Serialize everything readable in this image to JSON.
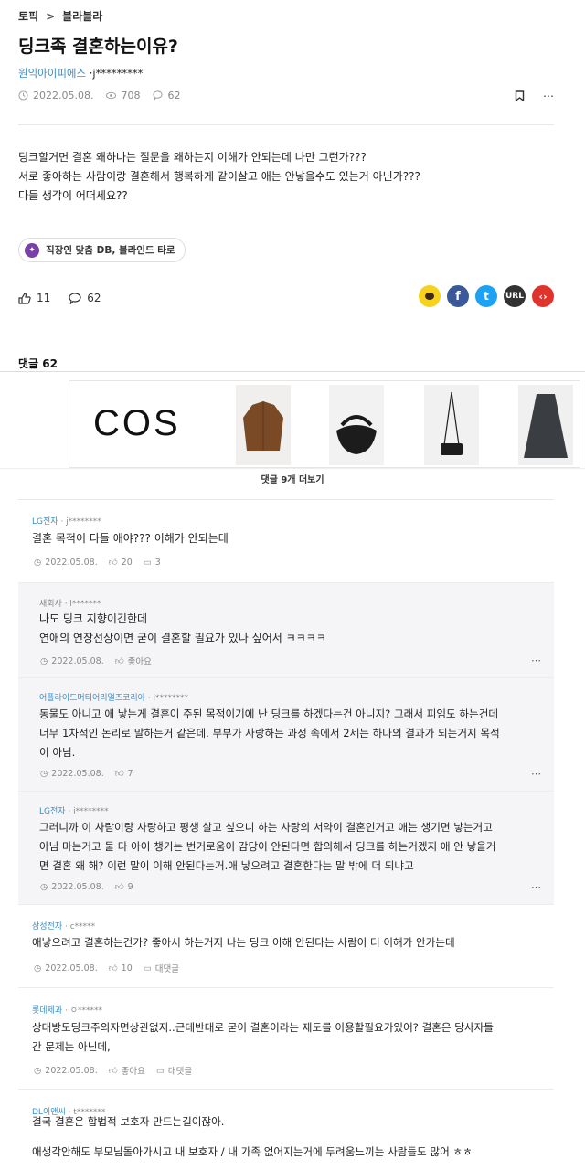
{
  "breadcrumb": {
    "topic": "토픽",
    "separator": ">",
    "board": "블라블라"
  },
  "post": {
    "title": "딩크족 결혼하는이유?",
    "company": "원익아이피에스",
    "author": "·j*********",
    "date": "2022.05.08.",
    "views": "708",
    "comments": "62",
    "lines": [
      "딩크할거면 결혼 왜하나는 질문을 왜하는지 이해가 안되는데 나만 그런가???",
      "서로 좋아하는 사람이랑 결혼해서 행복하게 같이살고 애는 안낳을수도 있는거 아닌가???",
      "다들 생각이 어떠세요??"
    ],
    "tag": "직장인 맞춤 DB, 블라인드 타로",
    "likes": "11",
    "comment_count": "62"
  },
  "share": [
    {
      "name": "kakao",
      "label": "",
      "color": "#f7d21d"
    },
    {
      "name": "facebook",
      "label": "f",
      "color": "#3b5998"
    },
    {
      "name": "twitter",
      "label": "t",
      "color": "#1da1f2"
    },
    {
      "name": "url",
      "label": "URL",
      "color": "#333333"
    },
    {
      "name": "embed",
      "label": "‹›",
      "color": "#e0332c"
    }
  ],
  "comments_header": "댓글 62",
  "ad": {
    "brand": "COS"
  },
  "more_replies": "댓글 9개 더보기",
  "comments": [
    {
      "company": "LG전자",
      "user": " · j********",
      "lines": [
        "결혼 목적이 다들 애야??? 이해가 안되는데"
      ],
      "date": "2022.05.08.",
      "likes": "20",
      "replies": "3"
    },
    {
      "company": "새회사",
      "user": " · l*******",
      "lines": [
        "나도 딩크 지향이긴한데",
        "연애의 연장선상이면 굳이 결혼할 필요가 있나 싶어서 ㅋㅋㅋㅋ"
      ],
      "date": "2022.05.08.",
      "likes": "좋아요"
    },
    {
      "company": "어플라이드머티어리얼즈코리아",
      "user": " · i********",
      "lines": [
        "동물도 아니고 애 낳는게 결혼이 주된 목적이기에 난 딩크를 하겠다는건 아니지? 그래서 피임도 하는건데",
        "너무 1차적인 논리로 말하는거 같은데. 부부가 사랑하는 과정 속에서 2세는 하나의 결과가 되는거지 목적",
        "이 아님."
      ],
      "date": "2022.05.08.",
      "likes": "7"
    },
    {
      "company": "LG전자",
      "user": " · i********",
      "lines": [
        "그러니까 이 사람이랑 사랑하고 평생 살고 싶으니 하는 사랑의 서약이 결혼인거고 애는 생기면 낳는거고",
        "아님 마는거고 둘 다 아이 챙기는 번거로움이 감당이 안된다면 합의해서 딩크를 하는거겠지 애 안 낳을거",
        "면 결혼 왜 해? 이런 말이 이해 안된다는거.애 낳으려고 결혼한다는 말 밖에 더 되냐고"
      ],
      "date": "2022.05.08.",
      "likes": "9"
    },
    {
      "company": "삼성전자",
      "user": " · c*****",
      "lines": [
        "애낳으려고 결혼하는건가? 좋아서 하는거지 나는 딩크 이해 안된다는 사람이 더 이해가 안가는데"
      ],
      "date": "2022.05.08.",
      "likes": "10",
      "replies": "대댓글"
    },
    {
      "company": "롯데제과",
      "user": " · ㅇ******",
      "lines": [
        "상대방도딩크주의자면상관없지..근데반대로 굳이 결혼이라는 제도를 이용할필요가있어? 결혼은 당사자들",
        "간 문제는 아닌데,"
      ],
      "date": "2022.05.08.",
      "likes": "좋아요",
      "replies": "대댓글"
    },
    {
      "company": "DL이앤씨",
      "user": " · t*******",
      "lines": [
        "결국 결혼은 합법적 보호자 만드는길이잖아.",
        "",
        "애생각안해도 부모님돌아가시고 내 보호자 / 내 가족 없어지는거에 두려움느끼는 사람들도 많어 ㅎㅎ"
      ]
    }
  ]
}
